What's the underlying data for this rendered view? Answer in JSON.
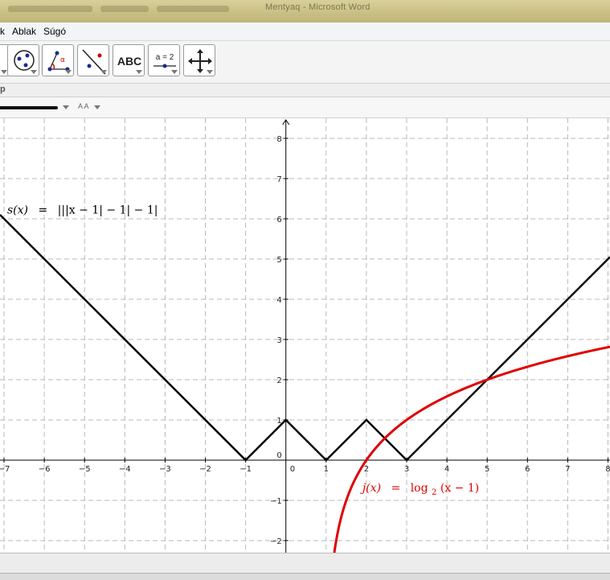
{
  "window": {
    "title": "Mentyaq - Microsoft Word"
  },
  "menu": {
    "items": [
      "k",
      "Ablak",
      "Súgó"
    ]
  },
  "toolbar": {
    "tools": [
      {
        "icon": "partial-tool-icon"
      },
      {
        "icon": "circle-through-points-icon"
      },
      {
        "icon": "angle-icon",
        "glyph": "α"
      },
      {
        "icon": "reflect-line-icon"
      },
      {
        "icon": "text-icon",
        "label": "ABC"
      },
      {
        "icon": "slider-icon",
        "label": "a = 2"
      },
      {
        "icon": "move-view-icon"
      }
    ]
  },
  "strip": {
    "label": "p"
  },
  "stylebar": {
    "text_size_glyph": "A A"
  },
  "chart_data": {
    "type": "line",
    "xlim": [
      -7.1,
      8.05
    ],
    "ylim": [
      -2.3,
      8.5
    ],
    "grid": true,
    "x_ticks": [
      -7,
      -6,
      -5,
      -4,
      -3,
      -2,
      -1,
      0,
      1,
      2,
      3,
      4,
      5,
      6,
      7,
      8
    ],
    "y_ticks": [
      -2,
      -1,
      0,
      1,
      2,
      3,
      4,
      5,
      6,
      7,
      8
    ],
    "series": [
      {
        "name": "s(x) = |||x − 1| − 1| − 1|",
        "color": "#000000",
        "x": [
          -7.1,
          -1,
          0,
          1,
          2,
          3,
          8.05
        ],
        "y": [
          6.1,
          0,
          1,
          0,
          1,
          0,
          5.05
        ]
      },
      {
        "name": "j(x) = log₂(x − 1)",
        "color": "#e00000",
        "x": [
          1.2,
          1.3,
          1.5,
          2,
          3,
          4,
          5,
          6,
          7,
          8
        ],
        "y": [
          -2.32,
          -1.74,
          -1,
          0,
          1,
          1.585,
          2,
          2.32,
          2.585,
          2.807
        ]
      }
    ],
    "labels": {
      "s": {
        "name": "s(x)",
        "eq": "=",
        "expr": "|||x − 1| − 1| − 1|"
      },
      "j": {
        "name": "j(x)",
        "eq": "=",
        "expr_head": "log",
        "sub": "2",
        "expr_tail": "(x − 1)"
      }
    }
  },
  "colors": {
    "grid": "#b8b8b8",
    "axis": "#000000",
    "s_curve": "#000000",
    "j_curve": "#e00000"
  }
}
